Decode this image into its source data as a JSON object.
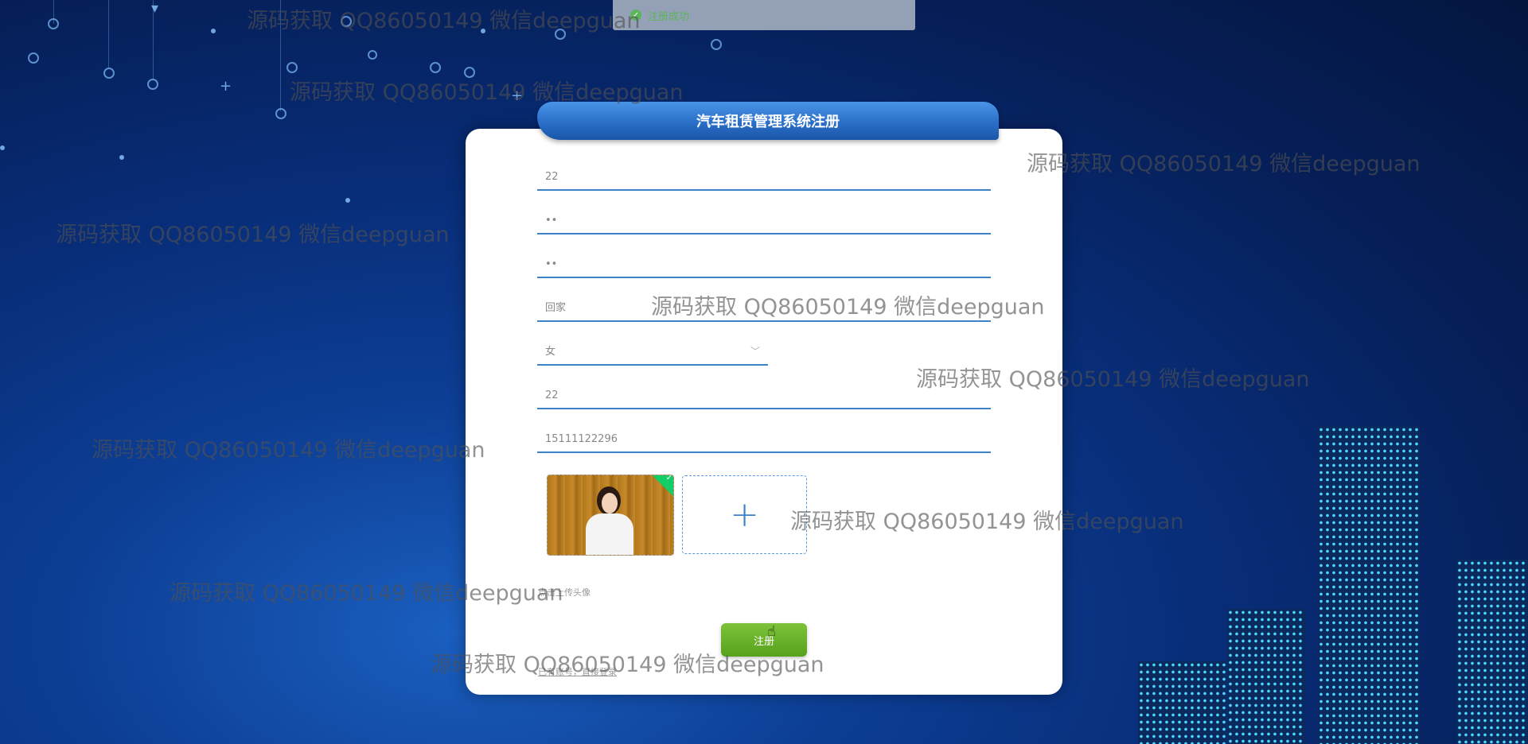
{
  "toast": {
    "message": "注册成功",
    "icon": "check-circle-icon"
  },
  "form": {
    "title": "汽车租赁管理系统注册",
    "fields": [
      {
        "name": "account",
        "value": "22"
      },
      {
        "name": "password",
        "value": "••"
      },
      {
        "name": "confirm_password",
        "value": "••"
      },
      {
        "name": "name",
        "value": "回家"
      },
      {
        "name": "gender",
        "value": "女"
      },
      {
        "name": "age",
        "value": "22"
      },
      {
        "name": "phone",
        "value": "15111122296"
      }
    ],
    "upload_add_icon": "+",
    "upload_hint": "点击上传头像",
    "submit_label": "注册",
    "login_link": "已有账号，直接登录"
  },
  "watermark": "源码获取 QQ86050149 微信deepguan",
  "colors": {
    "header": "#2a6fc8",
    "field_border": "#3b82c8",
    "submit": "#6ab22a",
    "toast_text": "#5bb55b"
  }
}
